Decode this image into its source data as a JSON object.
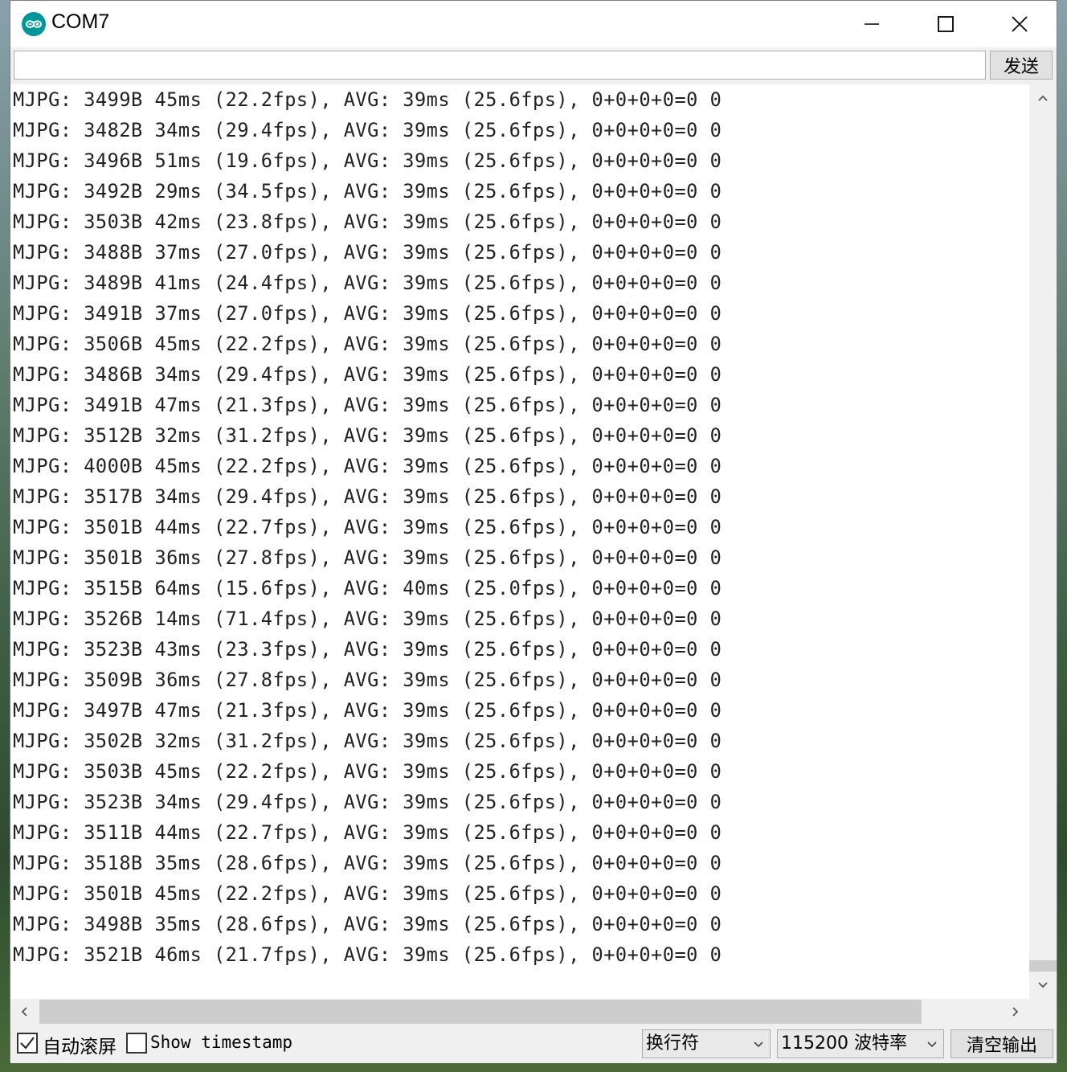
{
  "window": {
    "title": "COM7",
    "icon": "arduino-infinity-icon"
  },
  "send": {
    "input_value": "",
    "button_label": "发送"
  },
  "output": {
    "lines": [
      "MJPG: 3499B 45ms (22.2fps), AVG: 39ms (25.6fps), 0+0+0+0=0 0",
      "MJPG: 3482B 34ms (29.4fps), AVG: 39ms (25.6fps), 0+0+0+0=0 0",
      "MJPG: 3496B 51ms (19.6fps), AVG: 39ms (25.6fps), 0+0+0+0=0 0",
      "MJPG: 3492B 29ms (34.5fps), AVG: 39ms (25.6fps), 0+0+0+0=0 0",
      "MJPG: 3503B 42ms (23.8fps), AVG: 39ms (25.6fps), 0+0+0+0=0 0",
      "MJPG: 3488B 37ms (27.0fps), AVG: 39ms (25.6fps), 0+0+0+0=0 0",
      "MJPG: 3489B 41ms (24.4fps), AVG: 39ms (25.6fps), 0+0+0+0=0 0",
      "MJPG: 3491B 37ms (27.0fps), AVG: 39ms (25.6fps), 0+0+0+0=0 0",
      "MJPG: 3506B 45ms (22.2fps), AVG: 39ms (25.6fps), 0+0+0+0=0 0",
      "MJPG: 3486B 34ms (29.4fps), AVG: 39ms (25.6fps), 0+0+0+0=0 0",
      "MJPG: 3491B 47ms (21.3fps), AVG: 39ms (25.6fps), 0+0+0+0=0 0",
      "MJPG: 3512B 32ms (31.2fps), AVG: 39ms (25.6fps), 0+0+0+0=0 0",
      "MJPG: 4000B 45ms (22.2fps), AVG: 39ms (25.6fps), 0+0+0+0=0 0",
      "MJPG: 3517B 34ms (29.4fps), AVG: 39ms (25.6fps), 0+0+0+0=0 0",
      "MJPG: 3501B 44ms (22.7fps), AVG: 39ms (25.6fps), 0+0+0+0=0 0",
      "MJPG: 3501B 36ms (27.8fps), AVG: 39ms (25.6fps), 0+0+0+0=0 0",
      "MJPG: 3515B 64ms (15.6fps), AVG: 40ms (25.0fps), 0+0+0+0=0 0",
      "MJPG: 3526B 14ms (71.4fps), AVG: 39ms (25.6fps), 0+0+0+0=0 0",
      "MJPG: 3523B 43ms (23.3fps), AVG: 39ms (25.6fps), 0+0+0+0=0 0",
      "MJPG: 3509B 36ms (27.8fps), AVG: 39ms (25.6fps), 0+0+0+0=0 0",
      "MJPG: 3497B 47ms (21.3fps), AVG: 39ms (25.6fps), 0+0+0+0=0 0",
      "MJPG: 3502B 32ms (31.2fps), AVG: 39ms (25.6fps), 0+0+0+0=0 0",
      "MJPG: 3503B 45ms (22.2fps), AVG: 39ms (25.6fps), 0+0+0+0=0 0",
      "MJPG: 3523B 34ms (29.4fps), AVG: 39ms (25.6fps), 0+0+0+0=0 0",
      "MJPG: 3511B 44ms (22.7fps), AVG: 39ms (25.6fps), 0+0+0+0=0 0",
      "MJPG: 3518B 35ms (28.6fps), AVG: 39ms (25.6fps), 0+0+0+0=0 0",
      "MJPG: 3501B 45ms (22.2fps), AVG: 39ms (25.6fps), 0+0+0+0=0 0",
      "MJPG: 3498B 35ms (28.6fps), AVG: 39ms (25.6fps), 0+0+0+0=0 0",
      "MJPG: 3521B 46ms (21.7fps), AVG: 39ms (25.6fps), 0+0+0+0=0 0"
    ]
  },
  "footer": {
    "autoscroll_label": "自动滚屏",
    "autoscroll_checked": true,
    "timestamp_label": "Show timestamp",
    "timestamp_checked": false,
    "line_ending_value": "换行符",
    "baud_value": "115200 波特率",
    "clear_label": "清空输出"
  },
  "colors": {
    "arduino_teal": "#00979c"
  }
}
